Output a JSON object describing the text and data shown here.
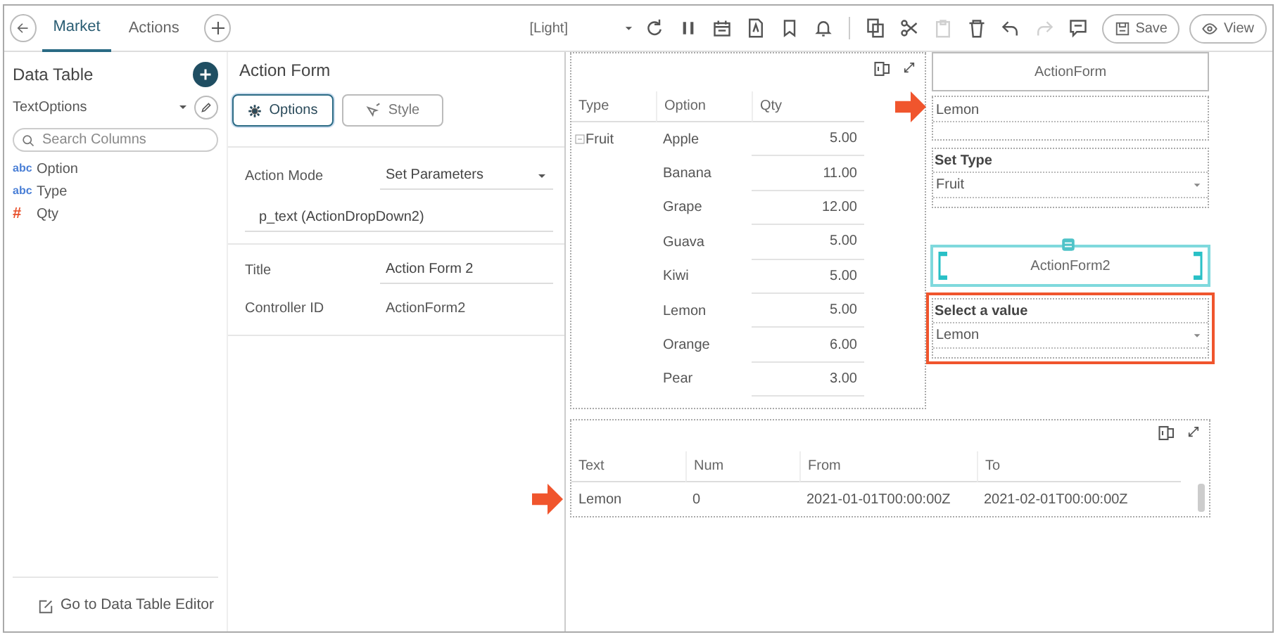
{
  "tabs": [
    {
      "label": "Market",
      "selected": true
    },
    {
      "label": "Actions",
      "selected": false
    }
  ],
  "toolbar": {
    "theme": "[Light]",
    "tools": [
      {
        "kind": "refresh",
        "disabled": false
      },
      {
        "kind": "pause",
        "disabled": false
      },
      {
        "kind": "calendar",
        "disabled": false
      },
      {
        "kind": "pdf",
        "disabled": false
      },
      {
        "kind": "bookmark",
        "disabled": false
      },
      {
        "kind": "bell",
        "disabled": false
      },
      {
        "kind": "separator"
      },
      {
        "kind": "copy",
        "disabled": false
      },
      {
        "kind": "cut",
        "disabled": false
      },
      {
        "kind": "paste",
        "disabled": true
      },
      {
        "kind": "trash",
        "disabled": false
      },
      {
        "kind": "undo",
        "disabled": false
      },
      {
        "kind": "redo",
        "disabled": true
      },
      {
        "kind": "comment",
        "disabled": false
      }
    ],
    "buttons": [
      {
        "kind": "save",
        "label": "Save"
      },
      {
        "kind": "view",
        "label": "View"
      }
    ]
  },
  "data_table_panel": {
    "title": "Data Table",
    "source": "TextOptions",
    "search": {
      "placeholder": "Search Columns"
    },
    "columns": [
      {
        "kind": "text",
        "type_label": "abc",
        "name": "Option"
      },
      {
        "kind": "text",
        "type_label": "abc",
        "name": "Type"
      },
      {
        "kind": "number",
        "type_label": "#",
        "name": "Qty"
      }
    ],
    "footer_link": "Go to Data Table Editor"
  },
  "action_form_panel": {
    "title": "Action Form",
    "tabs": [
      {
        "kind": "options",
        "label": "Options",
        "selected": true
      },
      {
        "kind": "style",
        "label": "Style",
        "selected": false
      }
    ],
    "action_mode": {
      "label": "Action Mode",
      "value": "Set Parameters",
      "parameter": "p_text (ActionDropDown2)"
    },
    "title_field": {
      "label": "Title",
      "value": "Action Form 2"
    },
    "controller_id": {
      "label": "Controller ID",
      "value": "ActionForm2"
    }
  },
  "table_widget": {
    "columns": [
      "Type",
      "Option",
      "Qty"
    ],
    "group": "Fruit",
    "rows": [
      {
        "option": "Apple",
        "qty": "5.00"
      },
      {
        "option": "Banana",
        "qty": "11.00"
      },
      {
        "option": "Grape",
        "qty": "12.00"
      },
      {
        "option": "Guava",
        "qty": "5.00"
      },
      {
        "option": "Kiwi",
        "qty": "5.00"
      },
      {
        "option": "Lemon",
        "qty": "5.00"
      },
      {
        "option": "Orange",
        "qty": "6.00"
      },
      {
        "option": "Pear",
        "qty": "3.00"
      }
    ]
  },
  "form_widgets": [
    {
      "kind": "button",
      "label": "ActionForm",
      "selected": false
    },
    {
      "kind": "text",
      "value": "Lemon",
      "selected": false,
      "arrow": true
    },
    {
      "kind": "dropdown",
      "label": "Set Type",
      "value": "Fruit",
      "selected": false
    },
    {
      "kind": "button",
      "label": "ActionForm2",
      "selected": true
    },
    {
      "kind": "dropdown",
      "label": "Select a value",
      "value": "Lemon",
      "selected": false,
      "highlighted": true
    }
  ],
  "result_table": {
    "columns": [
      "Text",
      "Num",
      "From",
      "To"
    ],
    "rows": [
      {
        "cells": [
          "Lemon",
          "0",
          "2021-01-01T00:00:00Z",
          "2021-02-01T00:00:00Z"
        ],
        "arrow": true
      }
    ]
  }
}
